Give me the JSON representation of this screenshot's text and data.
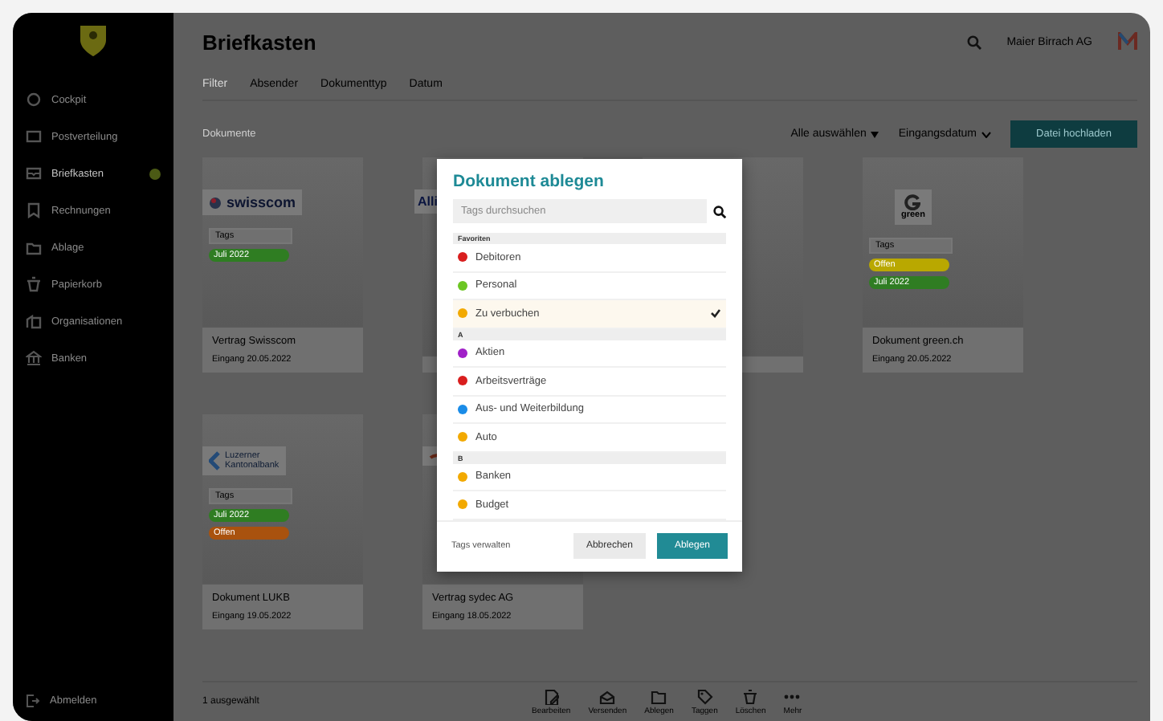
{
  "sidebar": {
    "items": [
      {
        "label": "Cockpit",
        "selected": false
      },
      {
        "label": "Postverteilung",
        "selected": false
      },
      {
        "label": "Briefkasten",
        "selected": true,
        "badge": true
      },
      {
        "label": "Rechnungen",
        "selected": false
      },
      {
        "label": "Ablage",
        "selected": false
      },
      {
        "label": "Papierkorb",
        "selected": false
      },
      {
        "label": "Organisationen",
        "selected": false
      },
      {
        "label": "Banken",
        "selected": false
      }
    ],
    "footer": "Abmelden"
  },
  "header": {
    "title": "Briefkasten",
    "company": "Maier Birrach AG"
  },
  "tabs": [
    {
      "label": "Filter",
      "selected": true
    },
    {
      "label": "Absender",
      "selected": false
    },
    {
      "label": "Dokumenttyp",
      "selected": false
    },
    {
      "label": "Datum",
      "selected": false
    }
  ],
  "toolbar": {
    "label": "Dokumente",
    "select_all": "Alle auswählen",
    "sort": "Eingangsdatum",
    "upload": "Datei hochladen"
  },
  "cards": [
    {
      "kind": "document",
      "logo": {
        "kind": "swisscom",
        "lines": [
          "swisscom"
        ]
      },
      "tags_field": "Tags",
      "tags": [
        {
          "label": "Juli 2022",
          "color": "#2f7d22"
        }
      ],
      "title": "Vertrag Swisscom",
      "date": "Eingang 20.05.2022"
    },
    {
      "kind": "document",
      "logo": {
        "kind": "allianz",
        "lines": [
          "Alli"
        ]
      }
    },
    {
      "kind": "document"
    },
    {
      "kind": "document",
      "logo": {
        "kind": "green",
        "lines": [
          "green"
        ]
      },
      "tags_field": "Tags",
      "tags": [
        {
          "label": "Offen",
          "color": "#b9a800"
        },
        {
          "label": "Juli 2022",
          "color": "#2f7d22"
        }
      ],
      "title": "Dokument green.ch",
      "date": "Eingang 20.05.2022"
    },
    {
      "kind": "document",
      "logo": {
        "kind": "lukb",
        "lines": [
          "Luzerner",
          "Kantonalbank"
        ]
      },
      "tags_field": "Tags",
      "tags": [
        {
          "label": "Juli 2022",
          "color": "#2f7d22"
        },
        {
          "label": "Offen",
          "color": "#a9520e"
        }
      ],
      "title": "Dokument LUKB",
      "date": "Eingang 19.05.2022"
    },
    {
      "kind": "document",
      "logo": {
        "kind": "sydec"
      },
      "title": "Vertrag sydec AG",
      "date": "Eingang 18.05.2022"
    }
  ],
  "bottom_bar": {
    "selection": "1 ausgewählt",
    "actions": [
      {
        "kind": "edit",
        "label": "Bearbeiten"
      },
      {
        "kind": "send",
        "label": "Versenden"
      },
      {
        "kind": "folder",
        "label": "Ablegen"
      },
      {
        "kind": "tag",
        "label": "Taggen"
      },
      {
        "kind": "trash",
        "label": "Löschen"
      },
      {
        "kind": "more",
        "label": "Mehr"
      }
    ]
  },
  "modal": {
    "title": "Dokument ablegen",
    "search": {
      "placeholder": "Tags durchsuchen"
    },
    "sections": [
      {
        "header": "Favoriten",
        "tags": [
          {
            "label": "Debitoren",
            "color": "#d91e1e",
            "selected": false
          },
          {
            "label": "Personal",
            "color": "#6cc623",
            "selected": false
          },
          {
            "label": "Zu verbuchen",
            "color": "#f2a900",
            "selected": true
          }
        ]
      },
      {
        "header": "A",
        "tags": [
          {
            "label": "Aktien",
            "color": "#a020c8",
            "selected": false
          },
          {
            "label": "Arbeitsverträge",
            "color": "#d91e1e",
            "selected": false
          },
          {
            "label": "Aus- und Weiterbildung",
            "color": "#1a8ce8",
            "selected": false
          },
          {
            "label": "Auto",
            "color": "#f2a900",
            "selected": false
          }
        ]
      },
      {
        "header": "B",
        "tags": [
          {
            "label": "Banken",
            "color": "#f2a900",
            "selected": false
          },
          {
            "label": "Budget",
            "color": "#f2a900",
            "selected": false
          }
        ]
      }
    ],
    "manage": "Tags verwalten",
    "cancel": "Abbrechen",
    "confirm": "Ablegen"
  }
}
